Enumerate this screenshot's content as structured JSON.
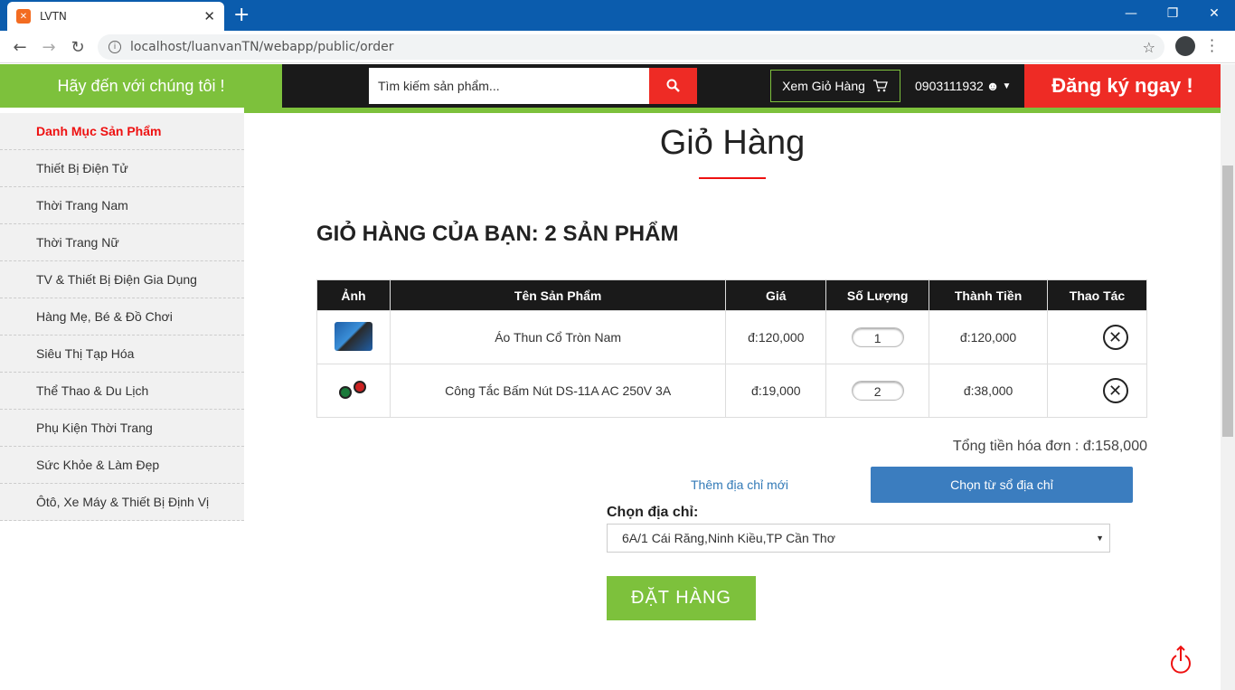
{
  "browser": {
    "tab_title": "LVTN",
    "url": "localhost/luanvanTN/webapp/public/order"
  },
  "header": {
    "greeting": "Hãy đến với chúng tôi !",
    "search_placeholder": "Tìm kiếm sản phẩm...",
    "cart_label": "Xem Giỏ Hàng",
    "phone": "0903111932",
    "register": "Đăng ký ngay !"
  },
  "sidebar": {
    "heading": "Danh Mục Sản Phẩm",
    "items": [
      "Thiết Bị Điện Tử",
      "Thời Trang Nam",
      "Thời Trang Nữ",
      "TV & Thiết Bị Điện Gia Dụng",
      "Hàng Mẹ, Bé & Đồ Chơi",
      "Siêu Thị Tạp Hóa",
      "Thể Thao & Du Lịch",
      "Phụ Kiện Thời Trang",
      "Sức Khỏe & Làm Đẹp",
      "Ôtô, Xe Máy & Thiết Bị Định Vị"
    ]
  },
  "main": {
    "page_title": "Giỏ Hàng",
    "cart_title": "GIỎ HÀNG CỦA BẠN: 2 SẢN PHẨM",
    "columns": [
      "Ảnh",
      "Tên Sản Phẩm",
      "Giá",
      "Số Lượng",
      "Thành Tiền",
      "Thao Tác"
    ],
    "rows": [
      {
        "name": "Áo Thun Cổ Tròn Nam",
        "price": "đ:120,000",
        "qty": "1",
        "subtotal": "đ:120,000"
      },
      {
        "name": "Công Tắc Bấm Nút DS-11A AC 250V 3A",
        "price": "đ:19,000",
        "qty": "2",
        "subtotal": "đ:38,000"
      }
    ],
    "total": "Tổng tiền hóa đơn : đ:158,000",
    "new_address": "Thêm địa chỉ mới",
    "pick_from_book": "Chọn từ sổ địa chỉ",
    "address_label": "Chọn địa chỉ:",
    "address_value": "6A/1 Cái Răng,Ninh Kiều,TP Cần Thơ",
    "order_button": "ĐẶT HÀNG"
  }
}
